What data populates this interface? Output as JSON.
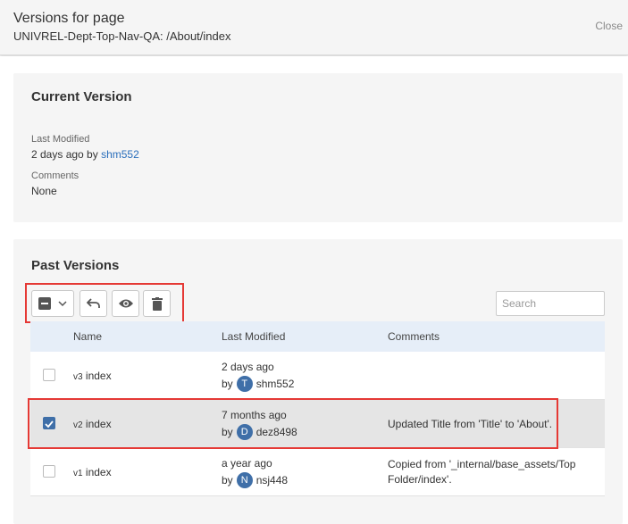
{
  "header": {
    "title": "Versions for page",
    "subtitle": "UNIVREL-Dept-Top-Nav-QA: /About/index",
    "close_label": "Close"
  },
  "current_version": {
    "heading": "Current Version",
    "last_modified_label": "Last Modified",
    "last_modified_prefix": "2 days ago by",
    "last_modified_user": "shm552",
    "comments_label": "Comments",
    "comments_value": "None"
  },
  "past_versions": {
    "heading": "Past Versions",
    "toolbar": {
      "select_icon": "checkbox-partial-icon",
      "dropdown_icon": "chevron-down-icon",
      "restore_icon": "undo-icon",
      "view_icon": "eye-icon",
      "delete_icon": "trash-icon"
    },
    "search": {
      "placeholder": "Search",
      "value": ""
    },
    "columns": [
      "Name",
      "Last Modified",
      "Comments"
    ],
    "rows": [
      {
        "version": "v3",
        "name": "index",
        "modified": "2 days ago",
        "by": "by",
        "avatar": "T",
        "user": "shm552",
        "comment_line1": "",
        "comment_line2": "",
        "selected": false
      },
      {
        "version": "v2",
        "name": "index",
        "modified": "7 months ago",
        "by": "by",
        "avatar": "D",
        "user": "dez8498",
        "comment_line1": "Updated Title from 'Title' to 'About'.",
        "comment_line2": "",
        "selected": true
      },
      {
        "version": "v1",
        "name": "index",
        "modified": "a year ago",
        "by": "by",
        "avatar": "N",
        "user": "nsj448",
        "comment_line1": "Copied from '_internal/base_assets/Top",
        "comment_line2": "Folder/index'.",
        "selected": false
      }
    ]
  },
  "colors": {
    "accent": "#3f6fa8",
    "highlight": "#e53935",
    "link": "#2a6ebb"
  }
}
